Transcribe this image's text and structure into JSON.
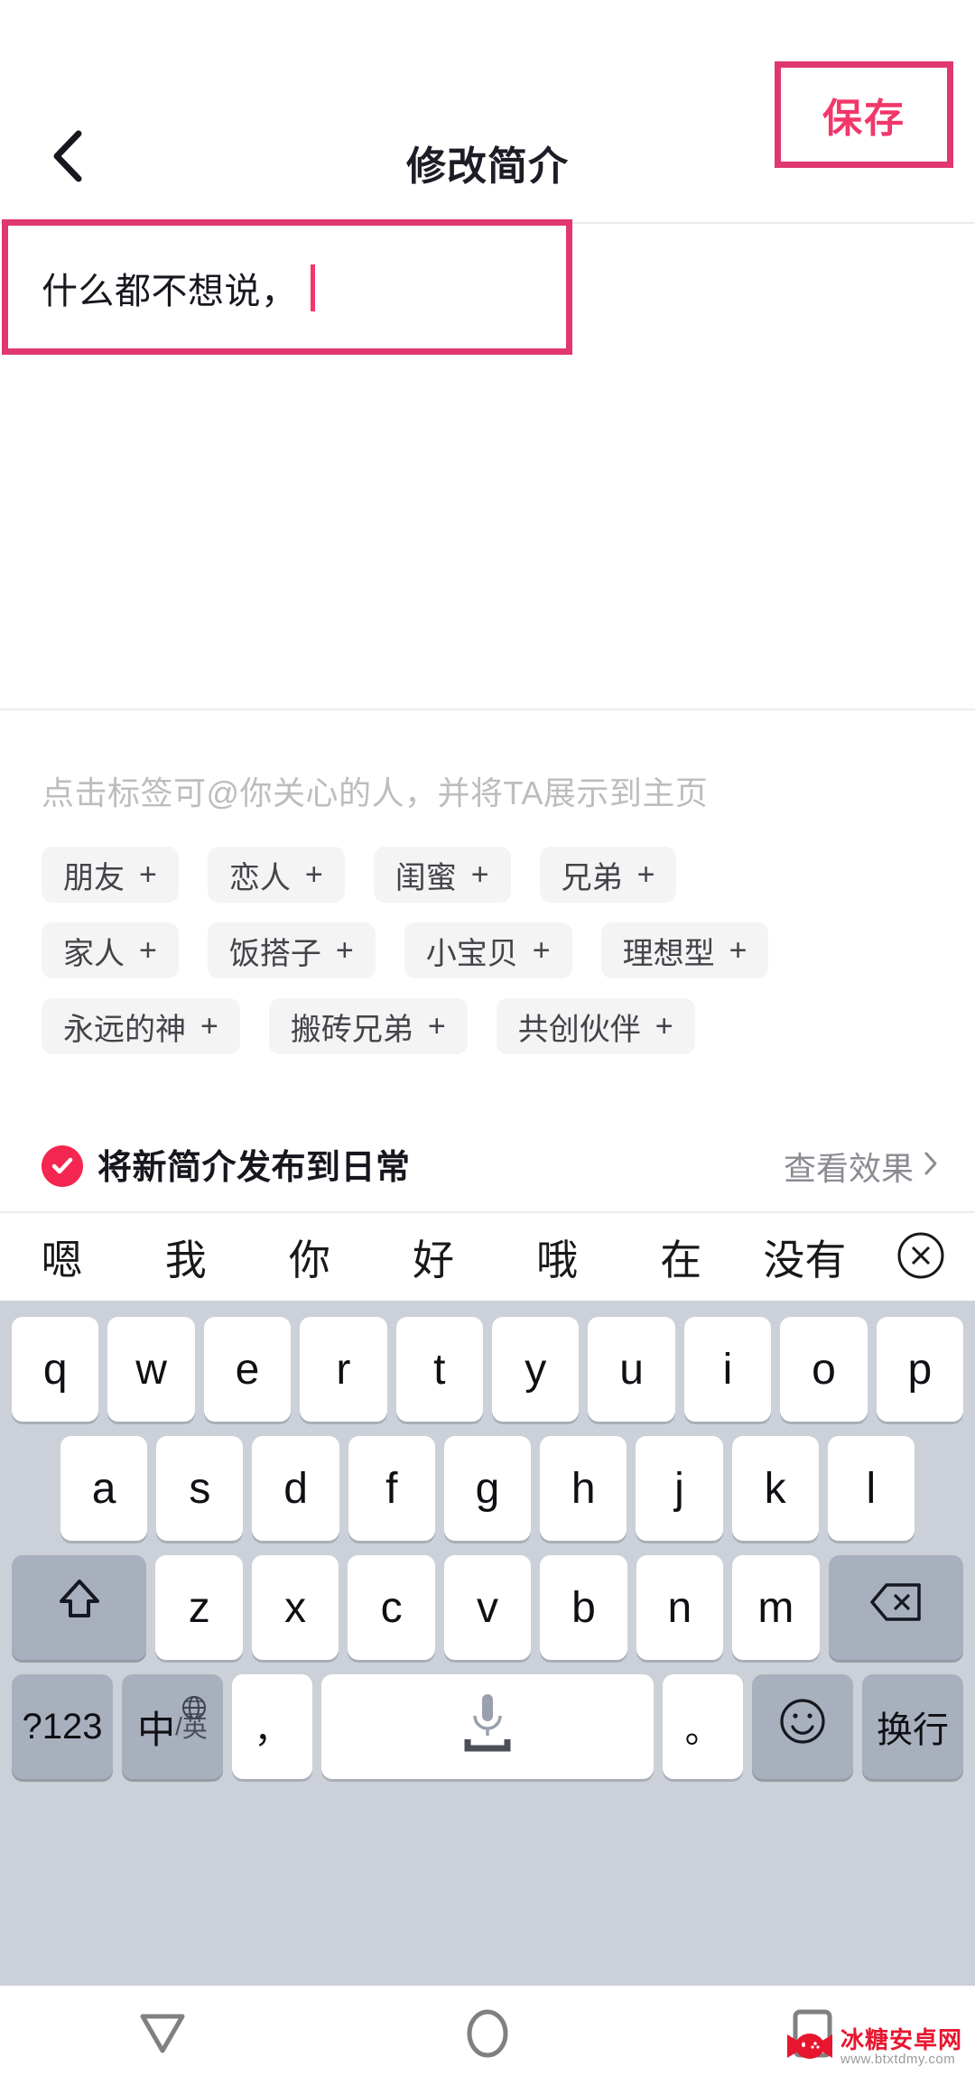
{
  "header": {
    "title": "修改简介",
    "back_icon": "chevron-left-icon",
    "save_label": "保存",
    "save_color": "#f2376a",
    "highlight_color": "#e0376f"
  },
  "bio": {
    "value": "什么都不想说，",
    "caret_color": "#f2376a"
  },
  "tags": {
    "hint": "点击标签可@你关心的人，并将TA展示到主页",
    "plus_glyph": "+",
    "rows": [
      [
        {
          "label": "朋友"
        },
        {
          "label": "恋人"
        },
        {
          "label": "闺蜜"
        },
        {
          "label": "兄弟"
        }
      ],
      [
        {
          "label": "家人"
        },
        {
          "label": "饭搭子"
        },
        {
          "label": "小宝贝"
        },
        {
          "label": "理想型"
        }
      ],
      [
        {
          "label": "永远的神"
        },
        {
          "label": "搬砖兄弟"
        },
        {
          "label": "共创伙伴"
        }
      ]
    ]
  },
  "publish": {
    "checked": true,
    "check_color": "#f5264f",
    "label": "将新简介发布到日常",
    "preview_label": "查看效果",
    "preview_chevron": "chevron-right-icon"
  },
  "keyboard": {
    "candidates": [
      "嗯",
      "我",
      "你",
      "好",
      "哦",
      "在",
      "没有"
    ],
    "close_icon": "circled-x-icon",
    "row1": [
      "q",
      "w",
      "e",
      "r",
      "t",
      "y",
      "u",
      "i",
      "o",
      "p"
    ],
    "row2": [
      "a",
      "s",
      "d",
      "f",
      "g",
      "h",
      "j",
      "k",
      "l"
    ],
    "row3_letters": [
      "z",
      "x",
      "c",
      "v",
      "b",
      "n",
      "m"
    ],
    "shift_icon": "shift-arrow-icon",
    "backspace_icon": "backspace-icon",
    "row4": {
      "symbols_label": "?123",
      "lang_zh": "中",
      "lang_sep": "/",
      "lang_en": "英",
      "globe_icon": "globe-icon",
      "comma": "，",
      "space_icon": "microphone-icon",
      "period": "。",
      "emoji_icon": "smiley-icon",
      "enter_label": "换行"
    }
  },
  "navbar": {
    "back_icon": "nav-back-triangle-icon",
    "home_icon": "nav-home-circle-icon",
    "recents_icon": "nav-recents-square-icon"
  },
  "watermark": {
    "title": "冰糖安卓网",
    "url": "www.btxtdmy.com"
  }
}
